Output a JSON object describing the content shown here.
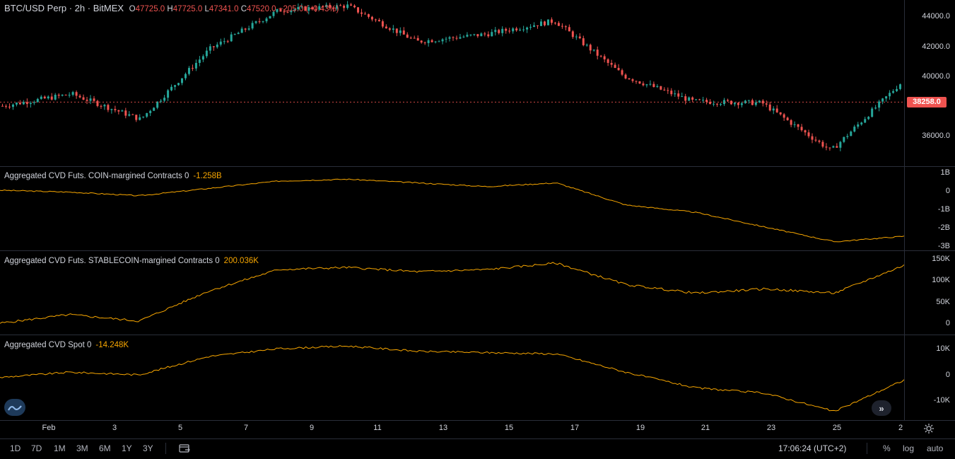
{
  "header": {
    "symbol": "BTC/USD Perp · 2h · BitMEX",
    "open_label": "O",
    "open": "47725.0",
    "high_label": "H",
    "high": "47725.0",
    "low_label": "L",
    "low": "47341.0",
    "close_label": "C",
    "close": "47520.0",
    "change": "−205.0 (−0.43%)"
  },
  "price_pane": {
    "ticks": [
      "44000.0",
      "42000.0",
      "40000.0",
      "36000.0"
    ],
    "last_price": "38258.0",
    "up_color": "#26a69a",
    "down_color": "#ef5350"
  },
  "cvd_coin": {
    "label": "Aggregated CVD Futs. COIN-margined Contracts 0",
    "value": "-1.258B",
    "ticks": [
      "1B",
      "0",
      "-1B",
      "-2B",
      "-3B"
    ]
  },
  "cvd_stable": {
    "label": "Aggregated CVD Futs. STABLECOIN-margined Contracts 0",
    "value": "200.036K",
    "ticks": [
      "150K",
      "100K",
      "50K",
      "0"
    ]
  },
  "cvd_spot": {
    "label": "Aggregated CVD Spot 0",
    "value": "-14.248K",
    "ticks": [
      "10K",
      "0",
      "-10K"
    ]
  },
  "line_color": "#f7a600",
  "time_axis": [
    "Feb",
    "3",
    "5",
    "7",
    "9",
    "11",
    "13",
    "15",
    "17",
    "19",
    "21",
    "23",
    "25",
    "2"
  ],
  "toolbar": {
    "ranges": [
      "1D",
      "7D",
      "1M",
      "3M",
      "6M",
      "1Y",
      "3Y"
    ],
    "clock": "17:06:24 (UTC+2)",
    "percent": "%",
    "log": "log",
    "auto": "auto"
  },
  "chart_data": {
    "type": "line",
    "x": [
      "Feb",
      "3",
      "5",
      "7",
      "9",
      "11",
      "13",
      "15",
      "17",
      "19",
      "21",
      "23",
      "25",
      "2"
    ],
    "price_close": [
      38000,
      38800,
      37100,
      41800,
      44400,
      44700,
      42300,
      42800,
      43700,
      40000,
      38300,
      38200,
      35000,
      39500
    ],
    "series": [
      {
        "name": "Aggregated CVD Futs. COIN-margined Contracts 0",
        "values": [
          0,
          -0.1,
          -0.3,
          0.1,
          0.5,
          0.6,
          0.4,
          0.2,
          0.4,
          -0.8,
          -1.2,
          -2.0,
          -2.8,
          -2.5
        ]
      },
      {
        "name": "Aggregated CVD Futs. STABLECOIN-margined Contracts 0",
        "values": [
          0,
          20000,
          5000,
          75000,
          125000,
          130000,
          120000,
          125000,
          140000,
          90000,
          70000,
          80000,
          70000,
          135000
        ]
      },
      {
        "name": "Aggregated CVD Spot 0",
        "values": [
          -1000,
          1000,
          0,
          7000,
          10000,
          11000,
          9000,
          8500,
          8000,
          1000,
          -5000,
          -7000,
          -14000,
          -2000
        ]
      }
    ]
  }
}
